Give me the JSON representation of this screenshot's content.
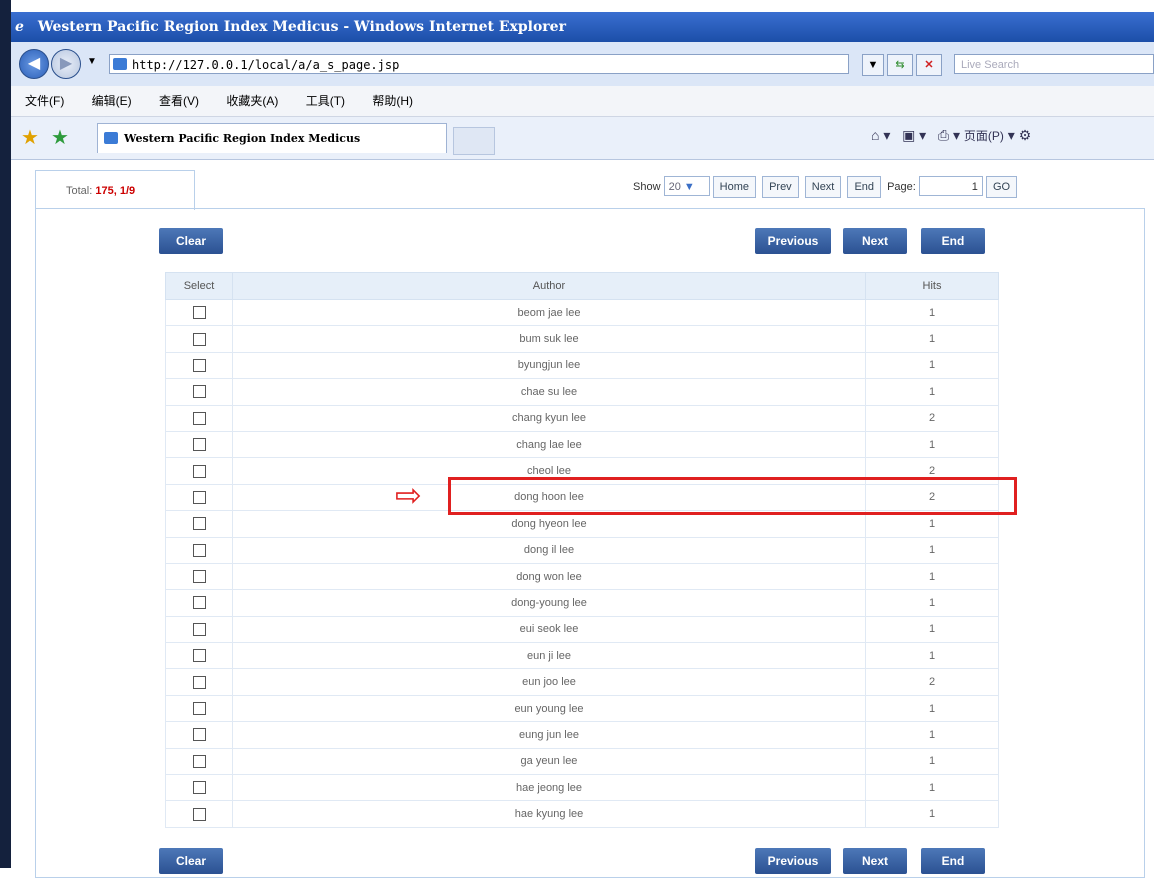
{
  "window": {
    "title": "Western Pacific Region Index Medicus - Windows Internet Explorer"
  },
  "address": {
    "url": "http://127.0.0.1/local/a/a_s_page.jsp",
    "search_placeholder": "Live Search"
  },
  "menu": {
    "items": [
      "文件(F)",
      "编辑(E)",
      "查看(V)",
      "收藏夹(A)",
      "工具(T)",
      "帮助(H)"
    ]
  },
  "tab": {
    "title": "Western Pacific Region Index Medicus",
    "page_menu": "页面(P)"
  },
  "info": {
    "total_label": "Total:",
    "total_value": "175, 1/9"
  },
  "pager": {
    "show_label": "Show",
    "show_value": "20",
    "home": "Home",
    "prev": "Prev",
    "next": "Next",
    "end": "End",
    "page_label": "Page:",
    "page_value": "1",
    "go": "GO"
  },
  "buttons": {
    "clear": "Clear",
    "previous": "Previous",
    "next": "Next",
    "end": "End"
  },
  "table": {
    "headers": [
      "Select",
      "Author",
      "Hits"
    ],
    "rows": [
      {
        "author": "beom jae lee",
        "hits": "1"
      },
      {
        "author": "bum suk lee",
        "hits": "1"
      },
      {
        "author": "byungjun lee",
        "hits": "1"
      },
      {
        "author": "chae su lee",
        "hits": "1"
      },
      {
        "author": "chang kyun lee",
        "hits": "2"
      },
      {
        "author": "chang lae lee",
        "hits": "1"
      },
      {
        "author": "cheol lee",
        "hits": "2"
      },
      {
        "author": "dong hoon lee",
        "hits": "2"
      },
      {
        "author": "dong hyeon lee",
        "hits": "1"
      },
      {
        "author": "dong il lee",
        "hits": "1"
      },
      {
        "author": "dong won lee",
        "hits": "1"
      },
      {
        "author": "dong-young lee",
        "hits": "1"
      },
      {
        "author": "eui seok lee",
        "hits": "1"
      },
      {
        "author": "eun ji lee",
        "hits": "1"
      },
      {
        "author": "eun joo lee",
        "hits": "2"
      },
      {
        "author": "eun young lee",
        "hits": "1"
      },
      {
        "author": "eung jun lee",
        "hits": "1"
      },
      {
        "author": "ga yeun lee",
        "hits": "1"
      },
      {
        "author": "hae jeong lee",
        "hits": "1"
      },
      {
        "author": "hae kyung lee",
        "hits": "1"
      }
    ]
  },
  "annotation": {
    "highlighted_row": "dong hoon lee",
    "color": "#e02020"
  }
}
